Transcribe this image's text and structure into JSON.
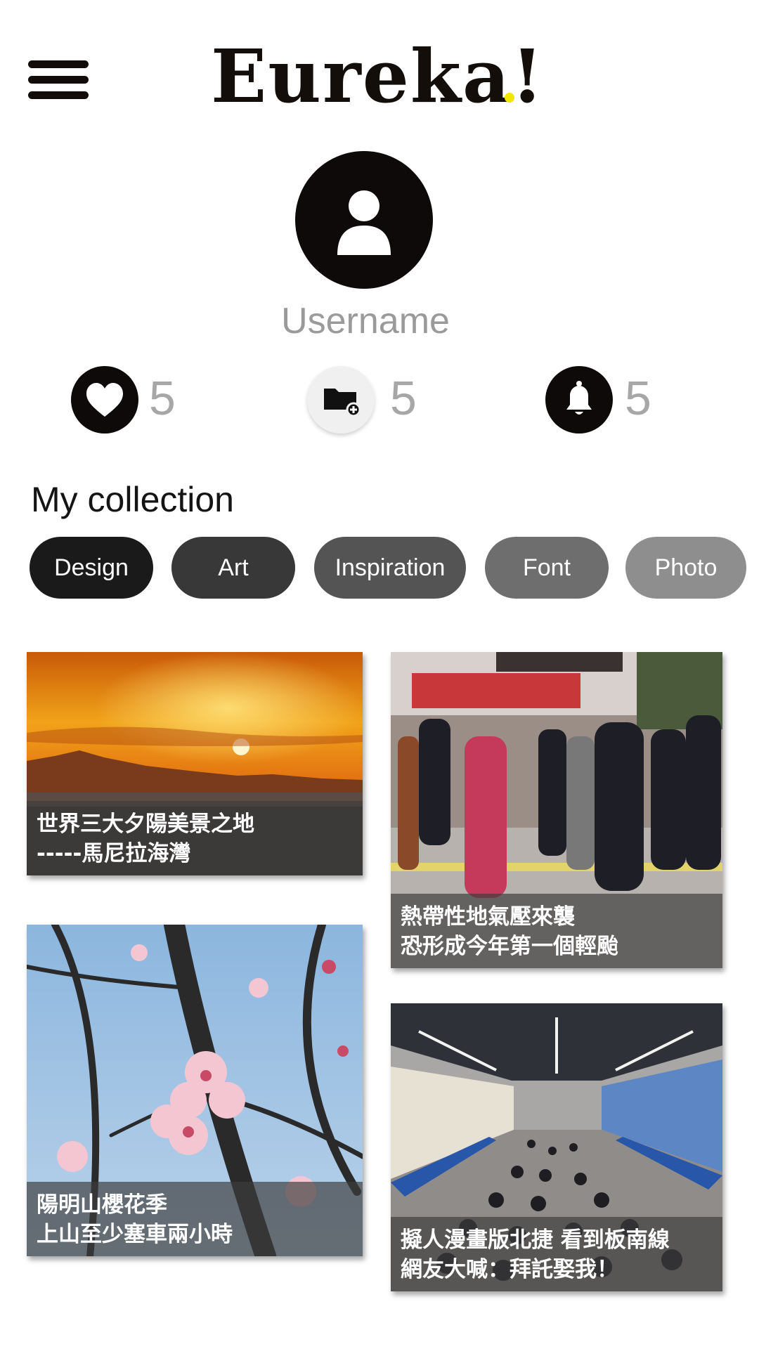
{
  "header": {
    "logo_text": "Eureka!",
    "logo_accent": "#f2e600"
  },
  "profile": {
    "username": "Username"
  },
  "stats": [
    {
      "icon": "heart-icon",
      "count": "5"
    },
    {
      "icon": "folder-add-icon",
      "count": "5"
    },
    {
      "icon": "bell-icon",
      "count": "5"
    }
  ],
  "collection": {
    "title": "My collection",
    "chips": [
      {
        "label": "Design",
        "color": "#1a1a1a"
      },
      {
        "label": "Art",
        "color": "#383838"
      },
      {
        "label": "Inspiration",
        "color": "#545454"
      },
      {
        "label": "Font",
        "color": "#6e6e6e"
      },
      {
        "label": "Photo",
        "color": "#8e8e8e"
      }
    ]
  },
  "cards": [
    {
      "line1": "世界三大夕陽美景之地",
      "line2": "-----馬尼拉海灣"
    },
    {
      "line1": "熱帶性地氣壓來襲",
      "line2": "恐形成今年第一個輕颱"
    },
    {
      "line1": "陽明山櫻花季",
      "line2": "上山至少塞車兩小時"
    },
    {
      "line1": "擬人漫畫版北捷  看到板南線",
      "line2": "網友大喊：拜託娶我！"
    }
  ]
}
